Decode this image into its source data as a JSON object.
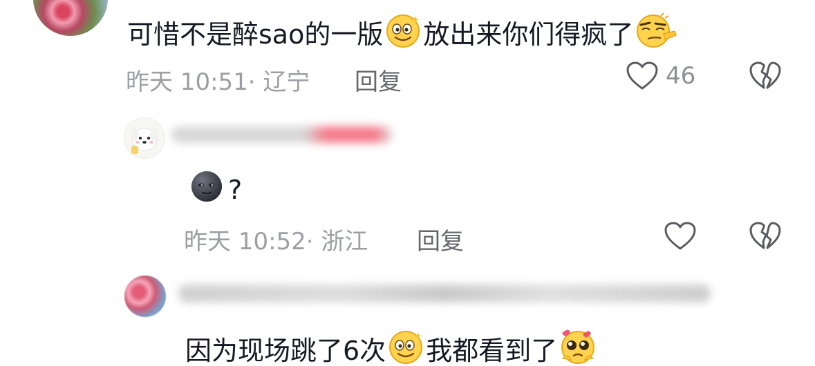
{
  "comments": [
    {
      "text_a": "可惜不是醉sao的一版",
      "text_b": "放出来你们得疯了",
      "emojis": [
        "smile-emoji",
        "smirk-emoji"
      ],
      "time_location": "昨天 10:51· 辽宁",
      "reply_label": "回复",
      "likes": "46"
    },
    {
      "text_a": "?",
      "emojis": [
        "dark-moon-face-emoji"
      ],
      "time_location": "昨天 10:52· 浙江",
      "reply_label": "回复"
    },
    {
      "text_a": "因为现场跳了6次",
      "text_b": "我都看到了",
      "emojis": [
        "smile-emoji",
        "pleading-emoji"
      ]
    }
  ],
  "colors": {
    "text": "#161823",
    "meta": "#9d9ea3",
    "icon": "#5a5b60"
  }
}
